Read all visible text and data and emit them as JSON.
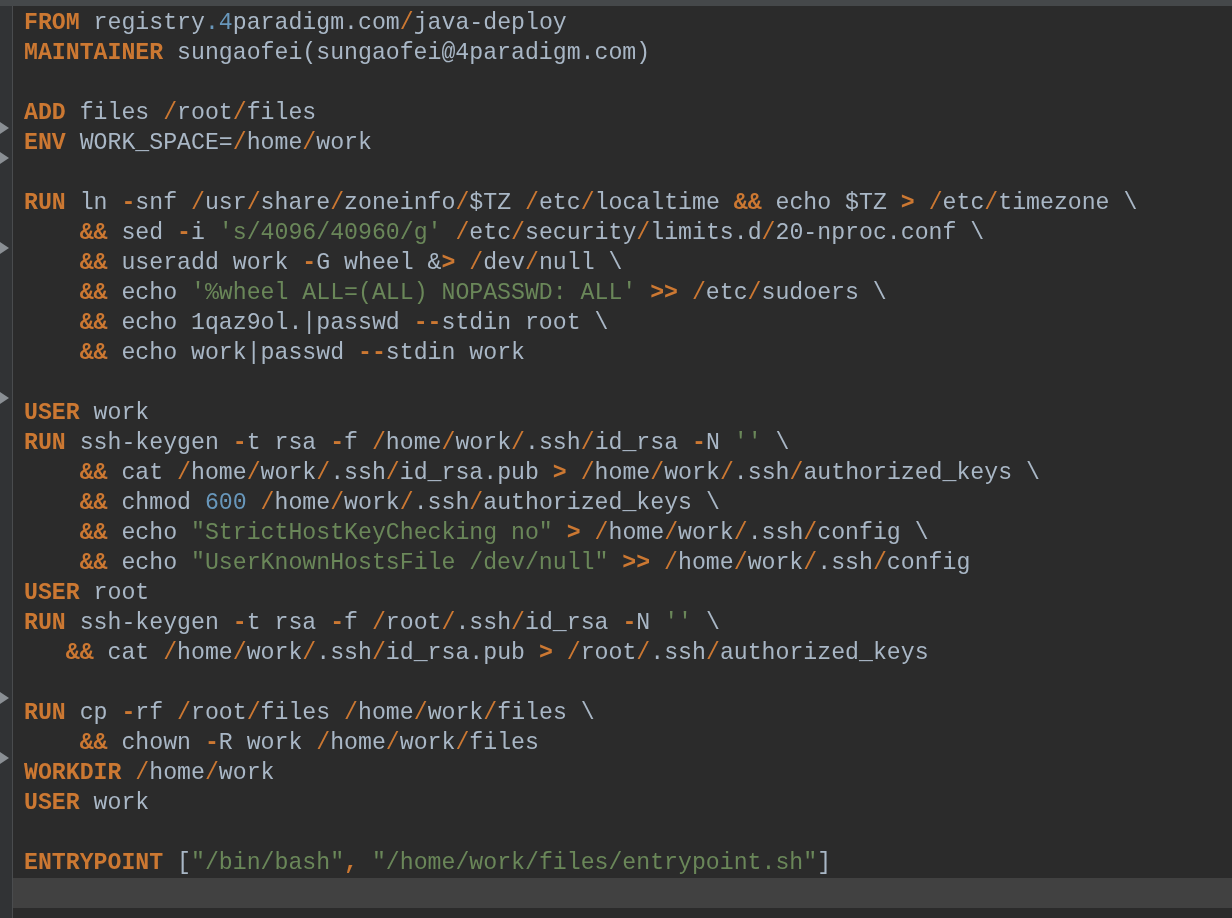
{
  "editor": {
    "lines": [
      {
        "fold_mark": false,
        "tokens": [
          {
            "kind": "keyword",
            "text": "FROM"
          },
          {
            "kind": "plain",
            "text": " registry"
          },
          {
            "kind": "number",
            "text": ".4"
          },
          {
            "kind": "path",
            "text": "paradigm.com/java-deploy"
          }
        ]
      },
      {
        "fold_mark": false,
        "tokens": [
          {
            "kind": "keyword",
            "text": "MAINTAINER"
          },
          {
            "kind": "plain",
            "text": " sungaofei(sungaofei@4paradigm.com)"
          }
        ]
      },
      {
        "fold_mark": false
      },
      {
        "fold_mark": false,
        "tokens": [
          {
            "kind": "keyword",
            "text": "ADD"
          },
          {
            "kind": "plain",
            "text": " files "
          },
          {
            "kind": "path",
            "text": "/root/files"
          }
        ]
      },
      {
        "fold_mark": true,
        "tokens": [
          {
            "kind": "keyword",
            "text": "ENV"
          },
          {
            "kind": "plain",
            "text": " WORK_SPACE="
          },
          {
            "kind": "path",
            "text": "/home/work"
          }
        ]
      },
      {
        "fold_mark": true
      },
      {
        "fold_mark": false,
        "tokens": [
          {
            "kind": "keyword",
            "text": "RUN"
          },
          {
            "kind": "plain",
            "text": " ln "
          },
          {
            "kind": "op",
            "text": "-"
          },
          {
            "kind": "plain",
            "text": "snf "
          },
          {
            "kind": "path",
            "text": "/usr/share/zoneinfo/$TZ "
          },
          {
            "kind": "path",
            "text": "/etc/localtime "
          },
          {
            "kind": "op",
            "text": "&&"
          },
          {
            "kind": "plain",
            "text": " echo $TZ "
          },
          {
            "kind": "op",
            "text": "> "
          },
          {
            "kind": "path",
            "text": "/etc/timezone"
          },
          {
            "kind": "plain",
            "text": " \\"
          }
        ]
      },
      {
        "fold_mark": false,
        "tokens": [
          {
            "kind": "op",
            "text": "    &&"
          },
          {
            "kind": "plain",
            "text": " sed "
          },
          {
            "kind": "op",
            "text": "-"
          },
          {
            "kind": "plain",
            "text": "i "
          },
          {
            "kind": "string",
            "text": "'s/4096/40960/g' "
          },
          {
            "kind": "path",
            "text": "/etc/security/limits.d/20-nproc.conf"
          },
          {
            "kind": "plain",
            "text": " \\"
          }
        ]
      },
      {
        "fold_mark": true,
        "tokens": [
          {
            "kind": "op",
            "text": "    &&"
          },
          {
            "kind": "plain",
            "text": " useradd work "
          },
          {
            "kind": "op",
            "text": "-"
          },
          {
            "kind": "plain",
            "text": "G wheel &"
          },
          {
            "kind": "op",
            "text": "> "
          },
          {
            "kind": "path",
            "text": "/dev/null"
          },
          {
            "kind": "plain",
            "text": " \\"
          }
        ]
      },
      {
        "fold_mark": false,
        "tokens": [
          {
            "kind": "op",
            "text": "    &&"
          },
          {
            "kind": "plain",
            "text": " echo "
          },
          {
            "kind": "string",
            "text": "'%wheel ALL=(ALL) NOPASSWD: ALL' "
          },
          {
            "kind": "op",
            "text": ">> "
          },
          {
            "kind": "path",
            "text": "/etc/sudoers"
          },
          {
            "kind": "plain",
            "text": " \\"
          }
        ]
      },
      {
        "fold_mark": false,
        "tokens": [
          {
            "kind": "op",
            "text": "    &&"
          },
          {
            "kind": "plain",
            "text": " echo 1qaz9ol.|passwd "
          },
          {
            "kind": "op",
            "text": "--"
          },
          {
            "kind": "plain",
            "text": "stdin root \\"
          }
        ]
      },
      {
        "fold_mark": false,
        "tokens": [
          {
            "kind": "op",
            "text": "    &&"
          },
          {
            "kind": "plain",
            "text": " echo work|passwd "
          },
          {
            "kind": "op",
            "text": "--"
          },
          {
            "kind": "plain",
            "text": "stdin work"
          }
        ]
      },
      {
        "fold_mark": false
      },
      {
        "fold_mark": true,
        "tokens": [
          {
            "kind": "keyword",
            "text": "USER"
          },
          {
            "kind": "plain",
            "text": " work"
          }
        ]
      },
      {
        "fold_mark": false,
        "tokens": [
          {
            "kind": "keyword",
            "text": "RUN"
          },
          {
            "kind": "plain",
            "text": " ssh-keygen "
          },
          {
            "kind": "op",
            "text": "-"
          },
          {
            "kind": "plain",
            "text": "t rsa "
          },
          {
            "kind": "op",
            "text": "-"
          },
          {
            "kind": "plain",
            "text": "f "
          },
          {
            "kind": "path",
            "text": "/home/work/.ssh/id_rsa "
          },
          {
            "kind": "op",
            "text": "-"
          },
          {
            "kind": "plain",
            "text": "N "
          },
          {
            "kind": "string",
            "text": "''"
          },
          {
            "kind": "plain",
            "text": " \\"
          }
        ]
      },
      {
        "fold_mark": false,
        "tokens": [
          {
            "kind": "op",
            "text": "    &&"
          },
          {
            "kind": "plain",
            "text": " cat "
          },
          {
            "kind": "path",
            "text": "/home/work/.ssh/id_rsa.pub "
          },
          {
            "kind": "op",
            "text": "> "
          },
          {
            "kind": "path",
            "text": "/home/work/.ssh/authorized_keys"
          },
          {
            "kind": "plain",
            "text": " \\"
          }
        ]
      },
      {
        "fold_mark": false,
        "tokens": [
          {
            "kind": "op",
            "text": "    &&"
          },
          {
            "kind": "plain",
            "text": " chmod "
          },
          {
            "kind": "number",
            "text": "600 "
          },
          {
            "kind": "path",
            "text": "/home/work/.ssh/authorized_keys"
          },
          {
            "kind": "plain",
            "text": " \\"
          }
        ]
      },
      {
        "fold_mark": false,
        "tokens": [
          {
            "kind": "op",
            "text": "    &&"
          },
          {
            "kind": "plain",
            "text": " echo "
          },
          {
            "kind": "string",
            "text": "\"StrictHostKeyChecking no\" "
          },
          {
            "kind": "op",
            "text": "> "
          },
          {
            "kind": "path",
            "text": "/home/work/.ssh/config"
          },
          {
            "kind": "plain",
            "text": " \\"
          }
        ]
      },
      {
        "fold_mark": false,
        "tokens": [
          {
            "kind": "op",
            "text": "    &&"
          },
          {
            "kind": "plain",
            "text": " echo "
          },
          {
            "kind": "string",
            "text": "\"UserKnownHostsFile /dev/null\" "
          },
          {
            "kind": "op",
            "text": ">> "
          },
          {
            "kind": "path",
            "text": "/home/work/.ssh/config"
          }
        ]
      },
      {
        "fold_mark": false,
        "tokens": [
          {
            "kind": "keyword",
            "text": "USER"
          },
          {
            "kind": "plain",
            "text": " root"
          }
        ]
      },
      {
        "fold_mark": false,
        "tokens": [
          {
            "kind": "keyword",
            "text": "RUN"
          },
          {
            "kind": "plain",
            "text": " ssh-keygen "
          },
          {
            "kind": "op",
            "text": "-"
          },
          {
            "kind": "plain",
            "text": "t rsa "
          },
          {
            "kind": "op",
            "text": "-"
          },
          {
            "kind": "plain",
            "text": "f "
          },
          {
            "kind": "path",
            "text": "/root/.ssh/id_rsa "
          },
          {
            "kind": "op",
            "text": "-"
          },
          {
            "kind": "plain",
            "text": "N "
          },
          {
            "kind": "string",
            "text": "''"
          },
          {
            "kind": "plain",
            "text": " \\"
          }
        ]
      },
      {
        "fold_mark": false,
        "tokens": [
          {
            "kind": "op",
            "text": "   &&"
          },
          {
            "kind": "plain",
            "text": " cat "
          },
          {
            "kind": "path",
            "text": "/home/work/.ssh/id_rsa.pub "
          },
          {
            "kind": "op",
            "text": "> "
          },
          {
            "kind": "path",
            "text": "/root/.ssh/authorized_keys"
          }
        ]
      },
      {
        "fold_mark": false
      },
      {
        "fold_mark": true,
        "tokens": [
          {
            "kind": "keyword",
            "text": "RUN"
          },
          {
            "kind": "plain",
            "text": " cp "
          },
          {
            "kind": "op",
            "text": "-"
          },
          {
            "kind": "plain",
            "text": "rf "
          },
          {
            "kind": "path",
            "text": "/root/files "
          },
          {
            "kind": "path",
            "text": "/home/work/files"
          },
          {
            "kind": "plain",
            "text": " \\"
          }
        ]
      },
      {
        "fold_mark": false,
        "tokens": [
          {
            "kind": "op",
            "text": "    &&"
          },
          {
            "kind": "plain",
            "text": " chown "
          },
          {
            "kind": "op",
            "text": "-"
          },
          {
            "kind": "plain",
            "text": "R work "
          },
          {
            "kind": "path",
            "text": "/home/work/files"
          }
        ]
      },
      {
        "fold_mark": true,
        "tokens": [
          {
            "kind": "keyword",
            "text": "WORKDIR "
          },
          {
            "kind": "path",
            "text": "/home/work"
          }
        ]
      },
      {
        "fold_mark": false,
        "tokens": [
          {
            "kind": "keyword",
            "text": "USER"
          },
          {
            "kind": "plain",
            "text": " work"
          }
        ]
      },
      {
        "fold_mark": false
      },
      {
        "fold_mark": false,
        "tokens": [
          {
            "kind": "keyword",
            "text": "ENTRYPOINT"
          },
          {
            "kind": "plain",
            "text": " ["
          },
          {
            "kind": "string",
            "text": "\"/bin/bash\""
          },
          {
            "kind": "op",
            "text": ", "
          },
          {
            "kind": "string",
            "text": "\"/home/work/files/entrypoint.sh\""
          },
          {
            "kind": "plain",
            "text": "]"
          }
        ]
      },
      {
        "fold_mark": false,
        "current": true
      }
    ]
  }
}
